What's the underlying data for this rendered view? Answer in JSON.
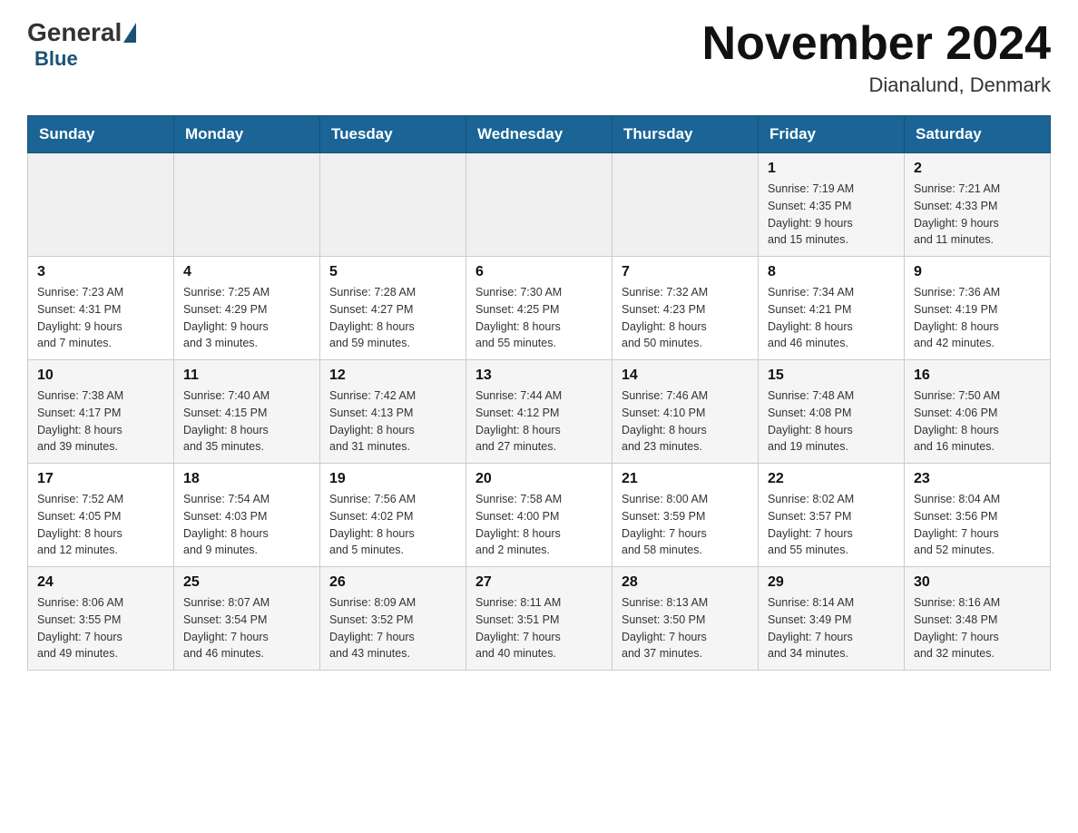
{
  "header": {
    "logo_general": "General",
    "logo_blue": "Blue",
    "main_title": "November 2024",
    "subtitle": "Dianalund, Denmark"
  },
  "weekdays": [
    "Sunday",
    "Monday",
    "Tuesday",
    "Wednesday",
    "Thursday",
    "Friday",
    "Saturday"
  ],
  "weeks": [
    [
      {
        "day": "",
        "info": ""
      },
      {
        "day": "",
        "info": ""
      },
      {
        "day": "",
        "info": ""
      },
      {
        "day": "",
        "info": ""
      },
      {
        "day": "",
        "info": ""
      },
      {
        "day": "1",
        "info": "Sunrise: 7:19 AM\nSunset: 4:35 PM\nDaylight: 9 hours\nand 15 minutes."
      },
      {
        "day": "2",
        "info": "Sunrise: 7:21 AM\nSunset: 4:33 PM\nDaylight: 9 hours\nand 11 minutes."
      }
    ],
    [
      {
        "day": "3",
        "info": "Sunrise: 7:23 AM\nSunset: 4:31 PM\nDaylight: 9 hours\nand 7 minutes."
      },
      {
        "day": "4",
        "info": "Sunrise: 7:25 AM\nSunset: 4:29 PM\nDaylight: 9 hours\nand 3 minutes."
      },
      {
        "day": "5",
        "info": "Sunrise: 7:28 AM\nSunset: 4:27 PM\nDaylight: 8 hours\nand 59 minutes."
      },
      {
        "day": "6",
        "info": "Sunrise: 7:30 AM\nSunset: 4:25 PM\nDaylight: 8 hours\nand 55 minutes."
      },
      {
        "day": "7",
        "info": "Sunrise: 7:32 AM\nSunset: 4:23 PM\nDaylight: 8 hours\nand 50 minutes."
      },
      {
        "day": "8",
        "info": "Sunrise: 7:34 AM\nSunset: 4:21 PM\nDaylight: 8 hours\nand 46 minutes."
      },
      {
        "day": "9",
        "info": "Sunrise: 7:36 AM\nSunset: 4:19 PM\nDaylight: 8 hours\nand 42 minutes."
      }
    ],
    [
      {
        "day": "10",
        "info": "Sunrise: 7:38 AM\nSunset: 4:17 PM\nDaylight: 8 hours\nand 39 minutes."
      },
      {
        "day": "11",
        "info": "Sunrise: 7:40 AM\nSunset: 4:15 PM\nDaylight: 8 hours\nand 35 minutes."
      },
      {
        "day": "12",
        "info": "Sunrise: 7:42 AM\nSunset: 4:13 PM\nDaylight: 8 hours\nand 31 minutes."
      },
      {
        "day": "13",
        "info": "Sunrise: 7:44 AM\nSunset: 4:12 PM\nDaylight: 8 hours\nand 27 minutes."
      },
      {
        "day": "14",
        "info": "Sunrise: 7:46 AM\nSunset: 4:10 PM\nDaylight: 8 hours\nand 23 minutes."
      },
      {
        "day": "15",
        "info": "Sunrise: 7:48 AM\nSunset: 4:08 PM\nDaylight: 8 hours\nand 19 minutes."
      },
      {
        "day": "16",
        "info": "Sunrise: 7:50 AM\nSunset: 4:06 PM\nDaylight: 8 hours\nand 16 minutes."
      }
    ],
    [
      {
        "day": "17",
        "info": "Sunrise: 7:52 AM\nSunset: 4:05 PM\nDaylight: 8 hours\nand 12 minutes."
      },
      {
        "day": "18",
        "info": "Sunrise: 7:54 AM\nSunset: 4:03 PM\nDaylight: 8 hours\nand 9 minutes."
      },
      {
        "day": "19",
        "info": "Sunrise: 7:56 AM\nSunset: 4:02 PM\nDaylight: 8 hours\nand 5 minutes."
      },
      {
        "day": "20",
        "info": "Sunrise: 7:58 AM\nSunset: 4:00 PM\nDaylight: 8 hours\nand 2 minutes."
      },
      {
        "day": "21",
        "info": "Sunrise: 8:00 AM\nSunset: 3:59 PM\nDaylight: 7 hours\nand 58 minutes."
      },
      {
        "day": "22",
        "info": "Sunrise: 8:02 AM\nSunset: 3:57 PM\nDaylight: 7 hours\nand 55 minutes."
      },
      {
        "day": "23",
        "info": "Sunrise: 8:04 AM\nSunset: 3:56 PM\nDaylight: 7 hours\nand 52 minutes."
      }
    ],
    [
      {
        "day": "24",
        "info": "Sunrise: 8:06 AM\nSunset: 3:55 PM\nDaylight: 7 hours\nand 49 minutes."
      },
      {
        "day": "25",
        "info": "Sunrise: 8:07 AM\nSunset: 3:54 PM\nDaylight: 7 hours\nand 46 minutes."
      },
      {
        "day": "26",
        "info": "Sunrise: 8:09 AM\nSunset: 3:52 PM\nDaylight: 7 hours\nand 43 minutes."
      },
      {
        "day": "27",
        "info": "Sunrise: 8:11 AM\nSunset: 3:51 PM\nDaylight: 7 hours\nand 40 minutes."
      },
      {
        "day": "28",
        "info": "Sunrise: 8:13 AM\nSunset: 3:50 PM\nDaylight: 7 hours\nand 37 minutes."
      },
      {
        "day": "29",
        "info": "Sunrise: 8:14 AM\nSunset: 3:49 PM\nDaylight: 7 hours\nand 34 minutes."
      },
      {
        "day": "30",
        "info": "Sunrise: 8:16 AM\nSunset: 3:48 PM\nDaylight: 7 hours\nand 32 minutes."
      }
    ]
  ],
  "colors": {
    "header_bg": "#1a6496",
    "header_text": "#ffffff",
    "row_odd": "#f5f5f5",
    "row_even": "#ffffff"
  }
}
